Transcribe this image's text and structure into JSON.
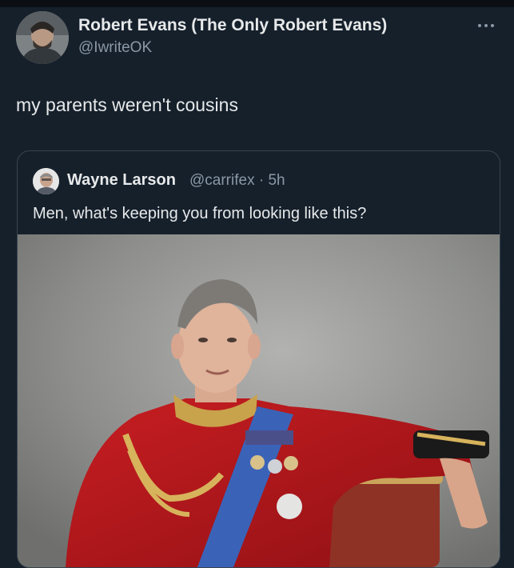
{
  "tweet": {
    "author_name": "Robert Evans (The Only Robert Evans)",
    "author_handle": "@IwriteOK",
    "more_icon": "more-horizontal-icon",
    "text": "my parents weren't cousins"
  },
  "quote": {
    "author_name": "Wayne Larson",
    "author_meta": "@carrifex · 5h",
    "text": "Men, what's keeping you from looking like this?"
  },
  "colors": {
    "background": "#15202b",
    "primary_text": "#e7e9ea",
    "secondary_text": "#8b98a5",
    "card_border": "#38444d"
  }
}
